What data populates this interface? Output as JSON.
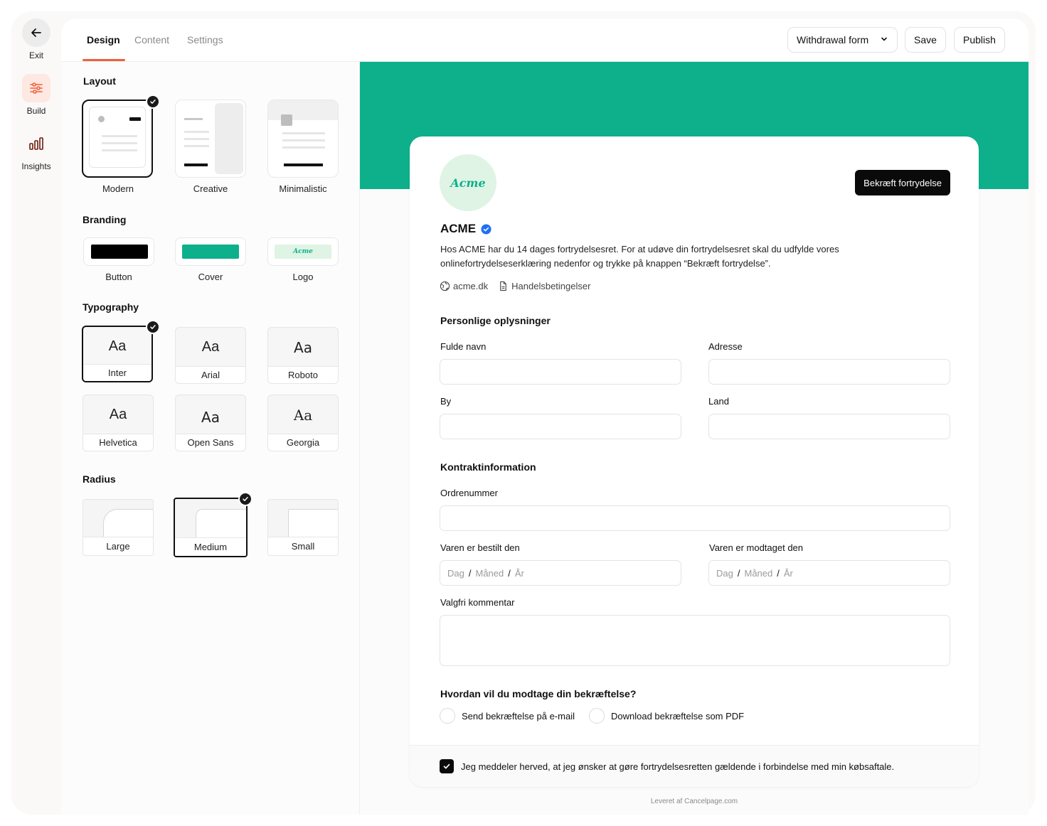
{
  "rail": {
    "exit_label": "Exit",
    "build_label": "Build",
    "insights_label": "Insights",
    "accent_color": "#f0603a"
  },
  "topbar": {
    "tabs": [
      "Design",
      "Content",
      "Settings"
    ],
    "active_tab": "Design",
    "form_select": "Withdrawal form",
    "save_label": "Save",
    "publish_label": "Publish"
  },
  "panel": {
    "layout": {
      "title": "Layout",
      "options": [
        "Modern",
        "Creative",
        "Minimalistic"
      ],
      "selected": "Modern"
    },
    "branding": {
      "title": "Branding",
      "options": [
        "Button",
        "Cover",
        "Logo"
      ],
      "logo_text": "Acme",
      "button_color": "#000000",
      "cover_color": "#0db08a"
    },
    "typography": {
      "title": "Typography",
      "sample": "Aa",
      "options": [
        "Inter",
        "Arial",
        "Roboto",
        "Helvetica",
        "Open Sans",
        "Georgia"
      ],
      "selected": "Inter"
    },
    "radius": {
      "title": "Radius",
      "options": [
        "Large",
        "Medium",
        "Small"
      ],
      "selected": "Medium"
    }
  },
  "preview": {
    "logo_text": "Acme",
    "confirm_button": "Bekræft fortrydelse",
    "company": "ACME",
    "description": "Hos ACME har du 14 dages fortrydelsesret. For at udøve din fortrydelsesret skal du udfylde vores onlinefortrydelseserklæring nedenfor og trykke på knappen “Bekræft fortrydelse”.",
    "website": "acme.dk",
    "terms": "Handelsbetingelser",
    "personal_title": "Personlige oplysninger",
    "fields": {
      "name": "Fulde navn",
      "address": "Adresse",
      "city": "By",
      "country": "Land"
    },
    "contract_title": "Kontraktinformation",
    "order_number": "Ordrenummer",
    "ordered_on": "Varen er bestilt den",
    "received_on": "Varen er modtaget den",
    "date_placeholder": {
      "day": "Dag",
      "month": "Måned",
      "year": "År",
      "sep": "/"
    },
    "comment": "Valgfri kommentar",
    "receipt_question": "Hvordan vil du modtage din bekræftelse?",
    "receipt_options": [
      "Send bekræftelse på e-mail",
      "Download bekræftelse som PDF"
    ],
    "consent": "Jeg meddeler herved, at jeg ønsker at gøre fortrydelsesretten gældende i forbindelse med min købsaftale.",
    "consent_checked": true,
    "footer": "Leveret af Cancelpage.com",
    "cover_color": "#0db08a"
  }
}
